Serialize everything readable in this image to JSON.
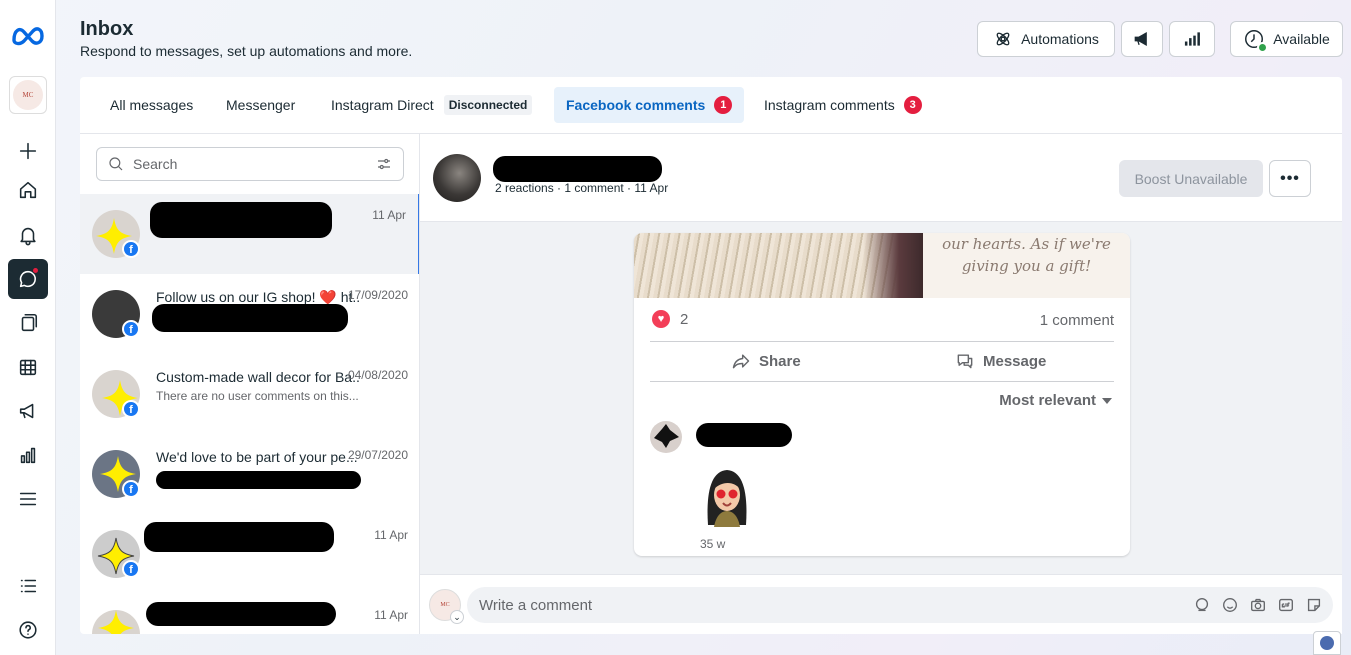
{
  "header": {
    "title": "Inbox",
    "subtitle": "Respond to messages, set up automations and more.",
    "automations_label": "Automations",
    "available_label": "Available",
    "status_color": "#31a24c"
  },
  "sidebar": {
    "avatar_text": "MC",
    "items": [
      {
        "name": "create",
        "icon": "plus-icon"
      },
      {
        "name": "home",
        "icon": "home-icon"
      },
      {
        "name": "notifications",
        "icon": "bell-icon"
      },
      {
        "name": "inbox",
        "icon": "chat-icon",
        "active": true
      },
      {
        "name": "content",
        "icon": "pages-icon"
      },
      {
        "name": "planner",
        "icon": "calendar-icon"
      },
      {
        "name": "ads",
        "icon": "megaphone-icon"
      },
      {
        "name": "insights",
        "icon": "bar-chart-icon"
      },
      {
        "name": "menu",
        "icon": "menu-icon"
      },
      {
        "name": "edit-list",
        "icon": "list-icon"
      },
      {
        "name": "help",
        "icon": "help-icon"
      }
    ]
  },
  "tabs": [
    {
      "label": "All messages"
    },
    {
      "label": "Messenger"
    },
    {
      "label": "Instagram Direct",
      "tag": "Disconnected"
    },
    {
      "label": "Facebook comments",
      "count": "1",
      "active": true
    },
    {
      "label": "Instagram comments",
      "count": "3"
    }
  ],
  "search": {
    "placeholder": "Search"
  },
  "conversations": [
    {
      "message": "",
      "preview": "",
      "date": "11 Apr"
    },
    {
      "message": "Follow us on our IG shop! ❤️ ht...",
      "preview": "",
      "date": "17/09/2020"
    },
    {
      "message": "Custom-made wall decor for Ba...",
      "preview": "There are no user comments on this...",
      "date": "04/08/2020"
    },
    {
      "message": "We'd love to be part of your pe...",
      "preview": "",
      "date": "29/07/2020"
    },
    {
      "message": "",
      "preview": "",
      "date": "11 Apr"
    },
    {
      "message": "",
      "preview": "",
      "date": "11 Apr"
    }
  ],
  "post": {
    "meta": "2 reactions · 1 comment · 11 Apr",
    "boost_label": "Boost Unavailable",
    "more_label": "•••",
    "image_caption": "our hearts. As if we're giving you a gift!",
    "reaction_count": "2",
    "comment_count": "1 comment",
    "share_label": "Share",
    "message_label": "Message",
    "sort_label": "Most relevant",
    "comment_time": "35 w"
  },
  "composer": {
    "placeholder": "Write a comment",
    "avatar_text": "MC"
  }
}
